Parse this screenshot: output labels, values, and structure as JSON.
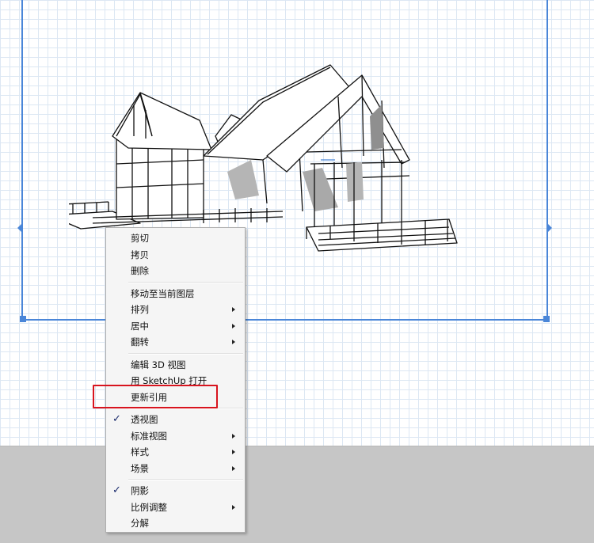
{
  "colors": {
    "selection": "#4a86d8",
    "highlight": "#d8141e",
    "check": "#1a2a6c"
  },
  "menu": {
    "groups": [
      [
        {
          "label": "剪切",
          "submenu": false,
          "checked": false
        },
        {
          "label": "拷贝",
          "submenu": false,
          "checked": false
        },
        {
          "label": "删除",
          "submenu": false,
          "checked": false
        }
      ],
      [
        {
          "label": "移动至当前图层",
          "submenu": false,
          "checked": false
        },
        {
          "label": "排列",
          "submenu": true,
          "checked": false
        },
        {
          "label": "居中",
          "submenu": true,
          "checked": false
        },
        {
          "label": "翻转",
          "submenu": true,
          "checked": false
        }
      ],
      [
        {
          "label": "编辑 3D 视图",
          "submenu": false,
          "checked": false
        },
        {
          "label": "用 SketchUp 打开",
          "submenu": false,
          "checked": false
        },
        {
          "label": "更新引用",
          "submenu": false,
          "checked": false
        }
      ],
      [
        {
          "label": "透视图",
          "submenu": false,
          "checked": true
        },
        {
          "label": "标准视图",
          "submenu": true,
          "checked": false
        },
        {
          "label": "样式",
          "submenu": true,
          "checked": false
        },
        {
          "label": "场景",
          "submenu": true,
          "checked": false
        }
      ],
      [
        {
          "label": "阴影",
          "submenu": false,
          "checked": true
        },
        {
          "label": "比例调整",
          "submenu": true,
          "checked": false
        },
        {
          "label": "分解",
          "submenu": false,
          "checked": false
        }
      ]
    ]
  }
}
